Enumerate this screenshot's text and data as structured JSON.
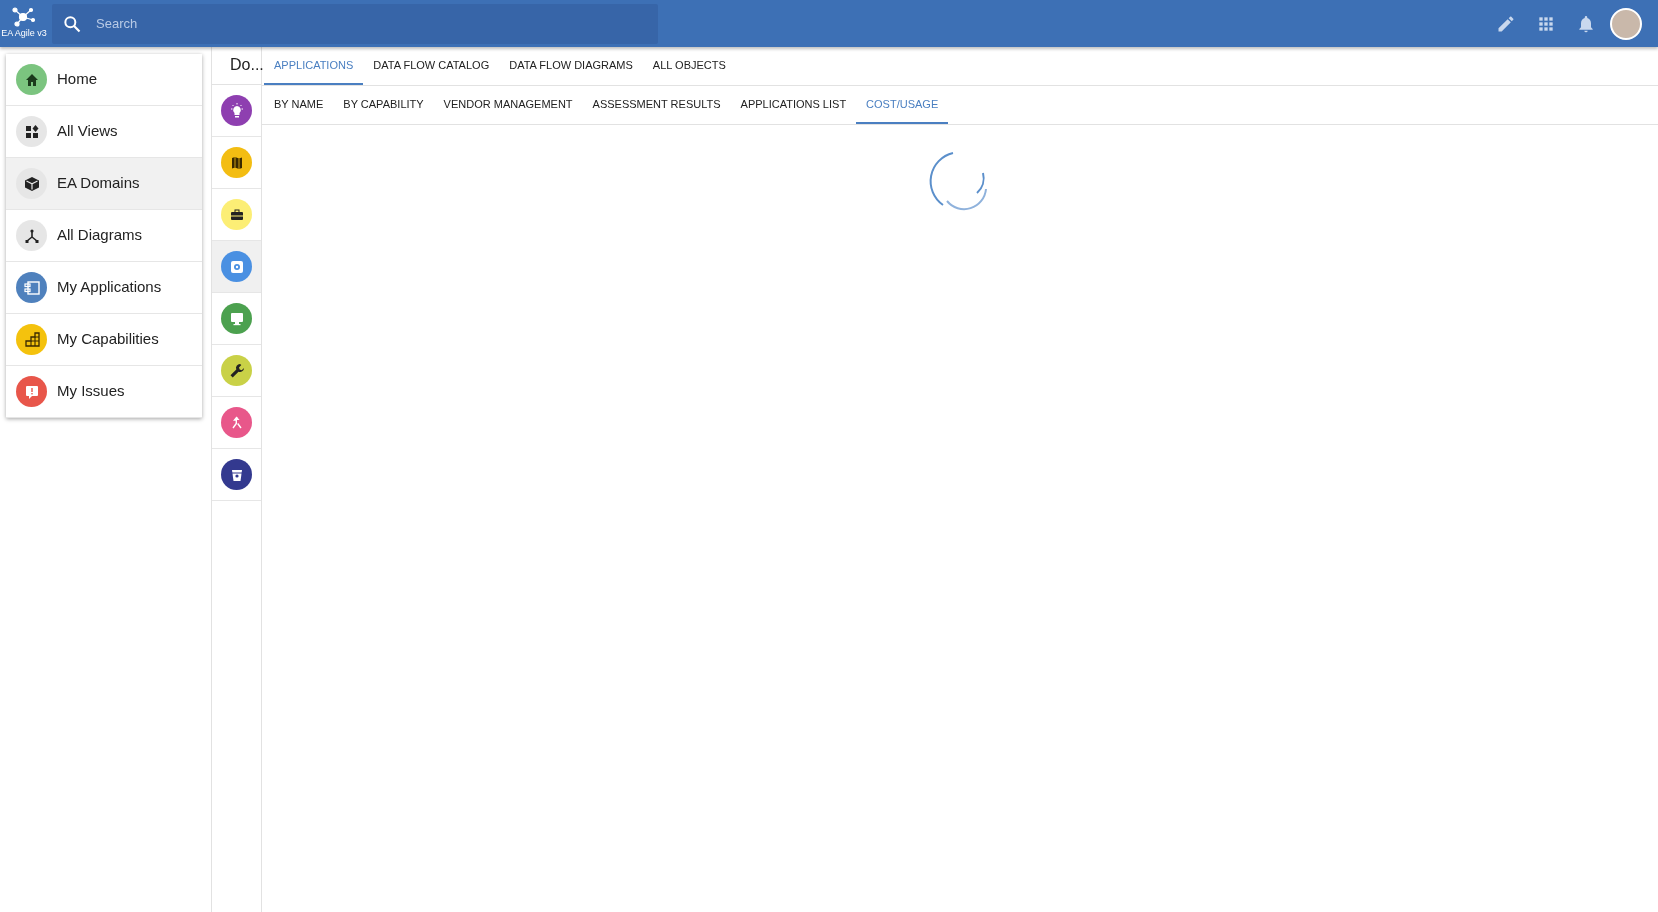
{
  "app": {
    "logo_text": "EA Agile v3"
  },
  "search": {
    "placeholder": "Search"
  },
  "menu": [
    {
      "label": "Home",
      "color": "#7bc47f",
      "selected": false
    },
    {
      "label": "All Views",
      "color": "#e6e6e6",
      "selected": false
    },
    {
      "label": "EA Domains",
      "color": "#e6e6e6",
      "selected": true
    },
    {
      "label": "All Diagrams",
      "color": "#e6e6e6",
      "selected": false
    },
    {
      "label": "My Applications",
      "color": "#4f81bd",
      "selected": false
    },
    {
      "label": "My Capabilities",
      "color": "#f4c20d",
      "selected": false
    },
    {
      "label": "My Issues",
      "color": "#e8564a",
      "selected": false
    }
  ],
  "domains": {
    "title": "Do...",
    "items": [
      {
        "color": "#8e3fb0",
        "selected": false
      },
      {
        "color": "#f3bd12",
        "selected": false
      },
      {
        "color": "#fcee75",
        "selected": false
      },
      {
        "color": "#4a90e2",
        "selected": true
      },
      {
        "color": "#4ca14f",
        "selected": false
      },
      {
        "color": "#c9d147",
        "selected": false
      },
      {
        "color": "#e8578a",
        "selected": false
      },
      {
        "color": "#33398f",
        "selected": false
      }
    ]
  },
  "tabs": [
    {
      "label": "APPLICATIONS",
      "selected": true
    },
    {
      "label": "DATA FLOW CATALOG",
      "selected": false
    },
    {
      "label": "DATA FLOW DIAGRAMS",
      "selected": false
    },
    {
      "label": "ALL OBJECTS",
      "selected": false
    }
  ],
  "subtabs": [
    {
      "label": "BY NAME",
      "selected": false
    },
    {
      "label": "BY CAPABILITY",
      "selected": false
    },
    {
      "label": "VENDOR MANAGEMENT",
      "selected": false
    },
    {
      "label": "ASSESSMENT RESULTS",
      "selected": false
    },
    {
      "label": "APPLICATIONS LIST",
      "selected": false
    },
    {
      "label": "COST/USAGE",
      "selected": true
    }
  ]
}
